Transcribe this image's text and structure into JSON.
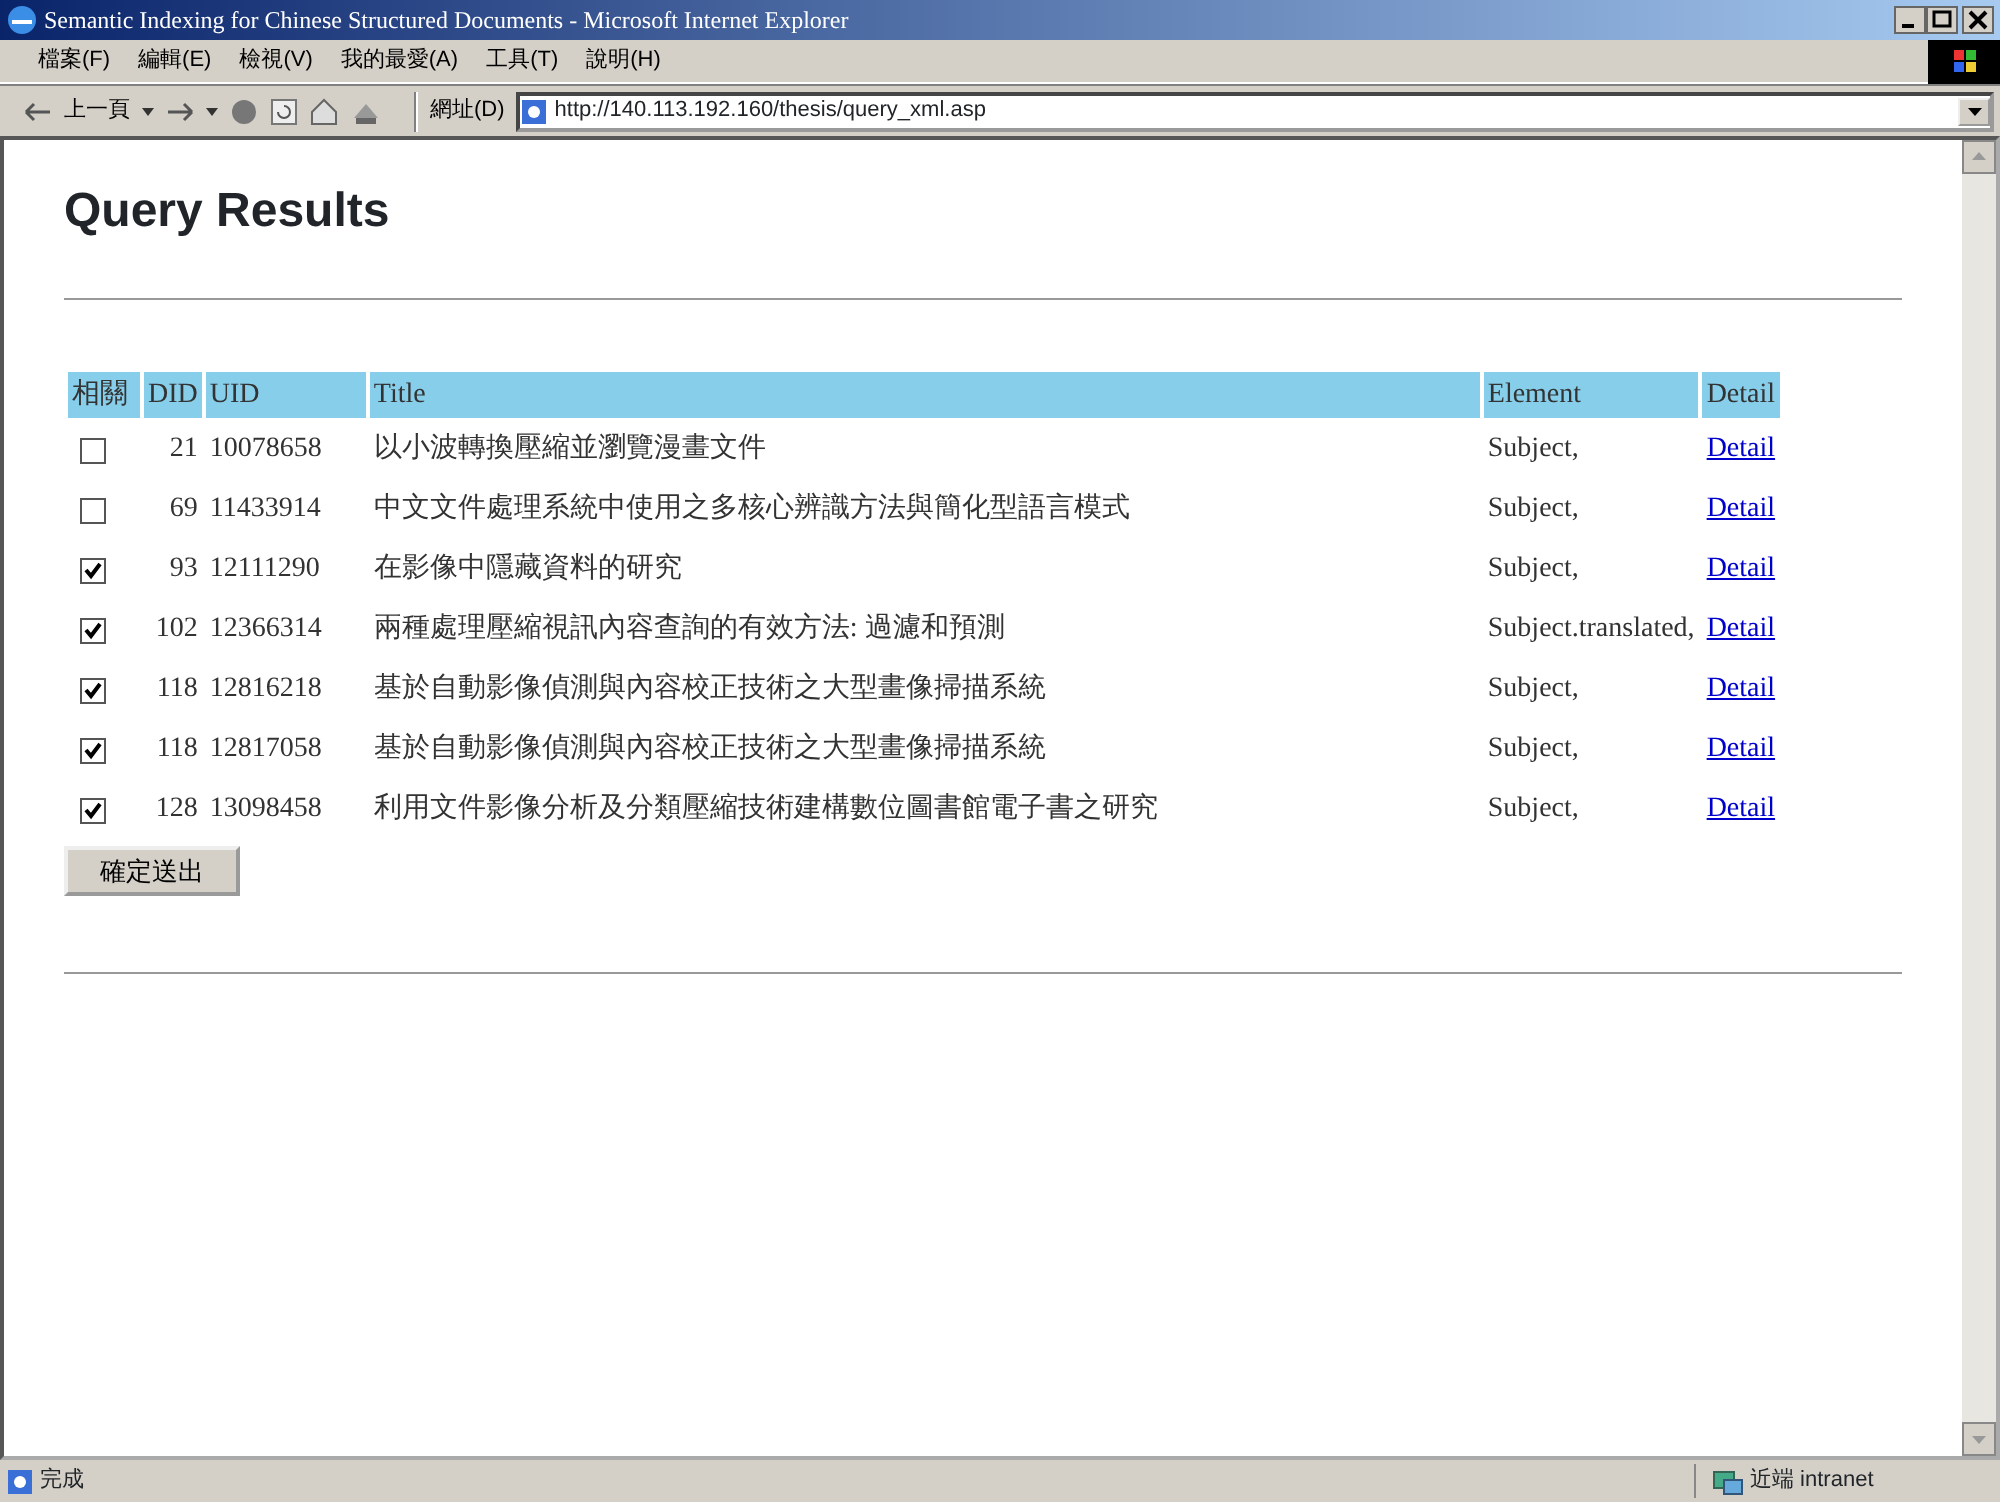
{
  "window": {
    "title": "Semantic Indexing for Chinese Structured Documents - Microsoft Internet Explorer"
  },
  "menu_bar": [
    "檔案(F)",
    "編輯(E)",
    "檢視(V)",
    "我的最愛(A)",
    "工具(T)",
    "說明(H)"
  ],
  "toolbar": {
    "back_label": "上一頁"
  },
  "address": {
    "label": "網址(D)",
    "value": "http://140.113.192.160/thesis/query_xml.asp"
  },
  "page": {
    "heading": "Query Results",
    "table": {
      "columns": [
        "相關",
        "DID",
        "UID",
        "Title",
        "Element",
        "Detail"
      ],
      "rows": [
        {
          "checked": false,
          "did": "21",
          "uid": "10078658",
          "title": "以小波轉換壓縮並瀏覽漫畫文件",
          "element": "Subject,",
          "detail": "Detail"
        },
        {
          "checked": false,
          "did": "69",
          "uid": "11433914",
          "title": "中文文件處理系統中使用之多核心辨識方法與簡化型語言模式",
          "element": "Subject,",
          "detail": "Detail"
        },
        {
          "checked": true,
          "did": "93",
          "uid": "12111290",
          "title": "在影像中隱藏資料的研究",
          "element": "Subject,",
          "detail": "Detail"
        },
        {
          "checked": true,
          "did": "102",
          "uid": "12366314",
          "title": "兩種處理壓縮視訊內容查詢的有效方法: 過濾和預測",
          "element": "Subject.translated,",
          "detail": "Detail"
        },
        {
          "checked": true,
          "did": "118",
          "uid": "12816218",
          "title": "基於自動影像偵測與內容校正技術之大型畫像掃描系統",
          "element": "Subject,",
          "detail": "Detail"
        },
        {
          "checked": true,
          "did": "118",
          "uid": "12817058",
          "title": "基於自動影像偵測與內容校正技術之大型畫像掃描系統",
          "element": "Subject,",
          "detail": "Detail"
        },
        {
          "checked": true,
          "did": "128",
          "uid": "13098458",
          "title": "利用文件影像分析及分類壓縮技術建構數位圖書館電子書之研究",
          "element": "Subject,",
          "detail": "Detail"
        }
      ]
    },
    "submit_button": "確定送出"
  },
  "status_bar": {
    "text": "完成",
    "zone": "近端 intranet"
  }
}
